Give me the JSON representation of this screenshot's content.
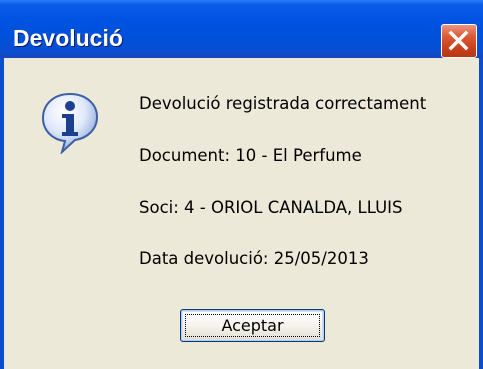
{
  "dialog": {
    "title": "Devolució",
    "icon": "information-icon",
    "close_icon": "close-icon",
    "colors": {
      "titlebar": "#0054e3",
      "close_button": "#d9532f",
      "body_background": "#ece9d8"
    },
    "messages": {
      "line1": "Devolució registrada correctament",
      "line2": "Document: 10 - El Perfume",
      "line3": "Soci: 4 - ORIOL CANALDA, LLUIS",
      "line4": "Data devolució: 25/05/2013"
    },
    "ok_label": "Aceptar"
  }
}
